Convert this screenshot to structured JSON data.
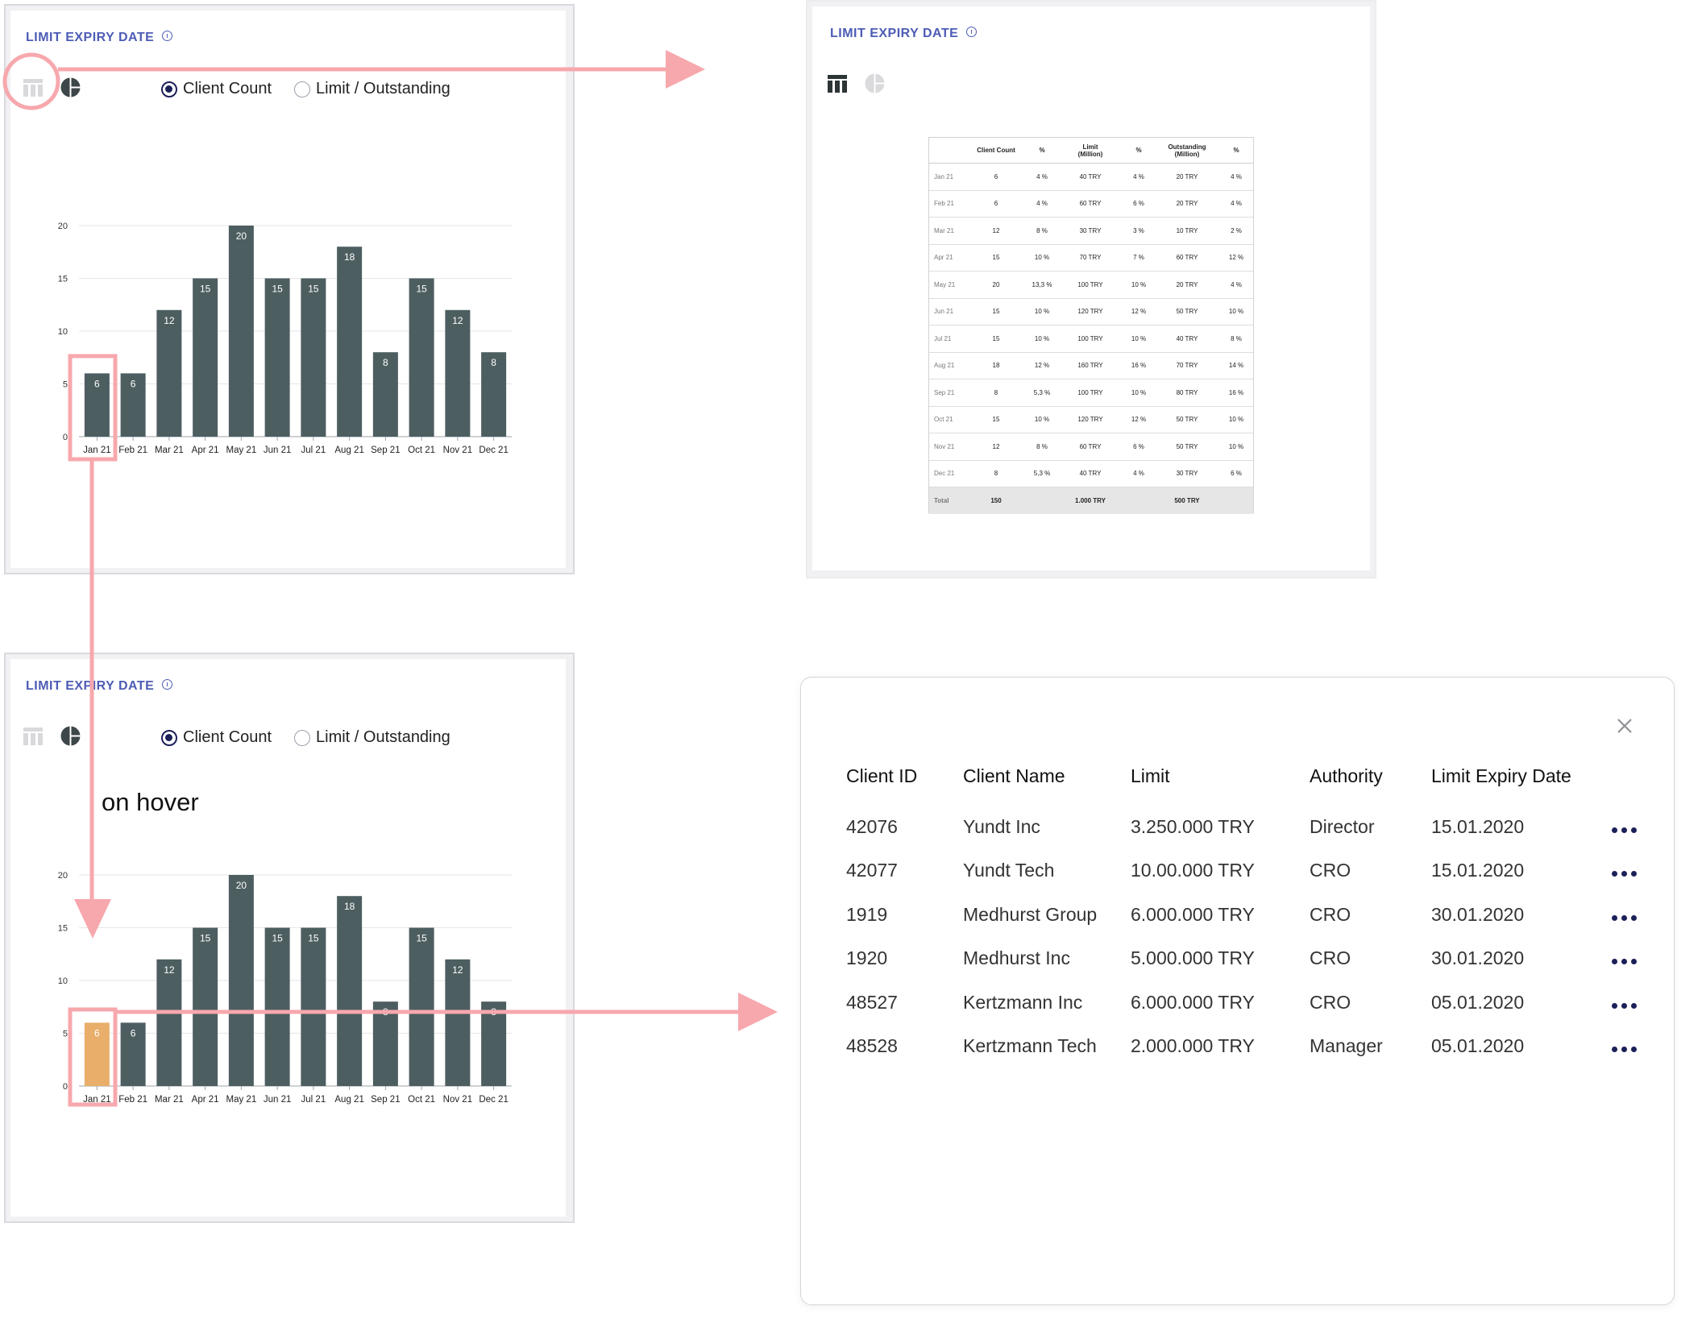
{
  "card_title": "LIMIT EXPIRY DATE",
  "radio": {
    "client_count": "Client Count",
    "limit_outstanding": "Limit / Outstanding"
  },
  "hover_note": "on hover",
  "chart_data": {
    "type": "bar",
    "categories": [
      "Jan 21",
      "Feb 21",
      "Mar 21",
      "Apr 21",
      "May 21",
      "Jun 21",
      "Jul 21",
      "Aug 21",
      "Sep 21",
      "Oct 21",
      "Nov 21",
      "Dec 21"
    ],
    "values": [
      6,
      6,
      12,
      15,
      20,
      15,
      15,
      18,
      8,
      15,
      12,
      8
    ],
    "yticks": [
      0,
      5,
      10,
      15,
      20
    ],
    "ylim": [
      0,
      20
    ],
    "bar_color": "#4d5e61",
    "hover_color": "#e8ae6a",
    "grid": true,
    "title": "",
    "xlabel": "",
    "ylabel": ""
  },
  "summary_table": {
    "headers": [
      "",
      "Client Count",
      "%",
      "Limit\n(Million)",
      "%",
      "Outstanding\n(Million)",
      "%"
    ],
    "rows": [
      [
        "Jan 21",
        "6",
        "4 %",
        "40 TRY",
        "4 %",
        "20 TRY",
        "4 %"
      ],
      [
        "Feb 21",
        "6",
        "4 %",
        "60 TRY",
        "6 %",
        "20 TRY",
        "4 %"
      ],
      [
        "Mar 21",
        "12",
        "8 %",
        "30 TRY",
        "3 %",
        "10 TRY",
        "2 %"
      ],
      [
        "Apr 21",
        "15",
        "10 %",
        "70 TRY",
        "7 %",
        "60 TRY",
        "12 %"
      ],
      [
        "May 21",
        "20",
        "13,3 %",
        "100 TRY",
        "10 %",
        "20 TRY",
        "4 %"
      ],
      [
        "Jun 21",
        "15",
        "10 %",
        "120 TRY",
        "12 %",
        "50 TRY",
        "10 %"
      ],
      [
        "Jul 21",
        "15",
        "10 %",
        "100 TRY",
        "10 %",
        "40 TRY",
        "8 %"
      ],
      [
        "Aug 21",
        "18",
        "12 %",
        "160 TRY",
        "16 %",
        "70 TRY",
        "14 %"
      ],
      [
        "Sep 21",
        "8",
        "5,3 %",
        "100 TRY",
        "10 %",
        "80 TRY",
        "16 %"
      ],
      [
        "Oct 21",
        "15",
        "10 %",
        "120 TRY",
        "12 %",
        "50 TRY",
        "10 %"
      ],
      [
        "Nov 21",
        "12",
        "8 %",
        "60 TRY",
        "6 %",
        "50 TRY",
        "10 %"
      ],
      [
        "Dec 21",
        "8",
        "5,3 %",
        "40 TRY",
        "4 %",
        "30 TRY",
        "6 %"
      ]
    ],
    "total": [
      "Total",
      "150",
      "",
      "1.000 TRY",
      "",
      "500 TRY",
      ""
    ]
  },
  "modal": {
    "headers": [
      "Client ID",
      "Client Name",
      "Limit",
      "Authority",
      "Limit Expiry Date"
    ],
    "rows": [
      [
        "42076",
        "Yundt Inc",
        "3.250.000 TRY",
        "Director",
        "15.01.2020"
      ],
      [
        "42077",
        "Yundt Tech",
        "10.00.000 TRY",
        "CRO",
        "15.01.2020"
      ],
      [
        "1919",
        "Medhurst Group",
        "6.000.000 TRY",
        "CRO",
        "30.01.2020"
      ],
      [
        "1920",
        "Medhurst Inc",
        "5.000.000 TRY",
        "CRO",
        "30.01.2020"
      ],
      [
        "48527",
        "Kertzmann Inc",
        "6.000.000 TRY",
        "CRO",
        "05.01.2020"
      ],
      [
        "48528",
        "Kertzmann  Tech",
        "2.000.000 TRY",
        "Manager",
        "05.01.2020"
      ]
    ]
  },
  "colors": {
    "accent": "#4d5cb5",
    "annotation": "#f7a8ad",
    "navy": "#1c2058"
  },
  "icons": [
    "table-icon",
    "pie-chart-icon",
    "info-icon",
    "close-icon",
    "more-options-icon"
  ]
}
